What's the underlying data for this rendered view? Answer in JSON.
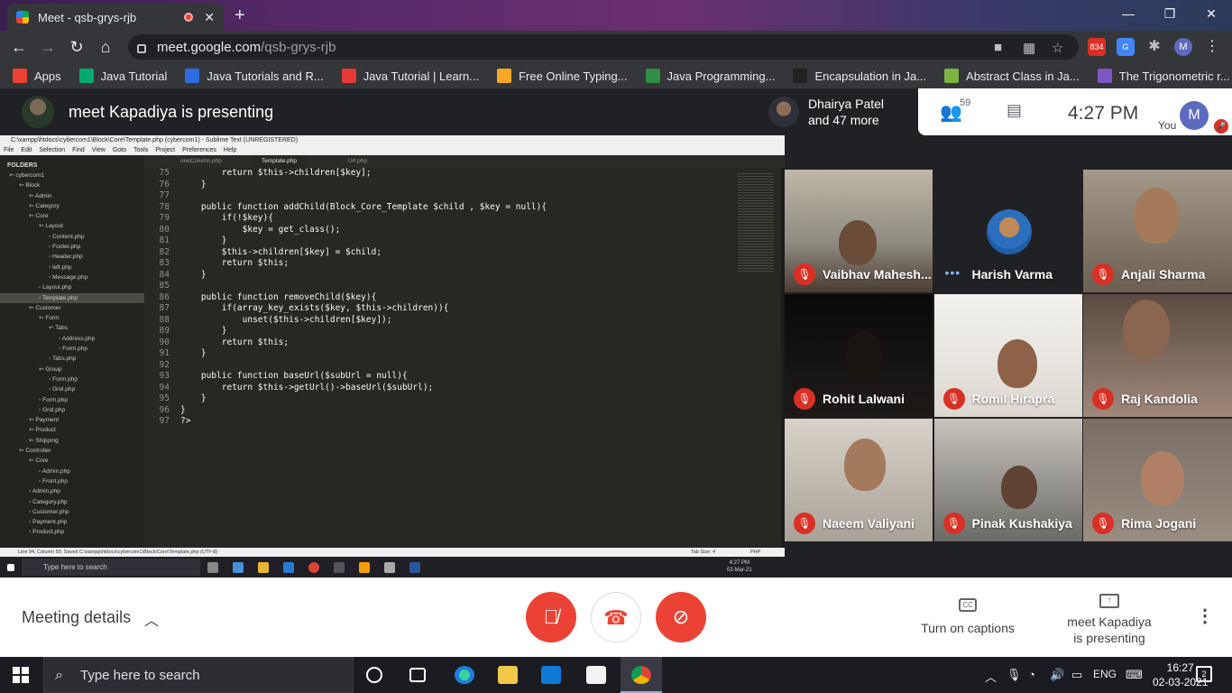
{
  "browser": {
    "tab_title": "Meet - qsb-grys-rjb",
    "new_tab": "+",
    "url_host": "meet.google.com",
    "url_path": "/qsb-grys-rjb",
    "ext_badge": "834"
  },
  "bookmarks": [
    {
      "label": "Apps",
      "icon": "apps-grid-icon",
      "color": "#ea4335"
    },
    {
      "label": "Java Tutorial",
      "icon": "w3-icon",
      "color": "#04aa6d"
    },
    {
      "label": "Java Tutorials and R...",
      "icon": "w-icon",
      "color": "#2b6cde"
    },
    {
      "label": "Java Tutorial | Learn...",
      "icon": "v-icon",
      "color": "#e53935"
    },
    {
      "label": "Free Online Typing...",
      "icon": "typing-icon",
      "color": "#f9a825"
    },
    {
      "label": "Java Programming...",
      "icon": "gfg-icon",
      "color": "#2f8d46"
    },
    {
      "label": "Encapsulation in Ja...",
      "icon": "s-icon",
      "color": "#222222"
    },
    {
      "label": "Abstract Class in Ja...",
      "icon": "b-icon",
      "color": "#7cb342"
    },
    {
      "label": "The Trigonometric r...",
      "icon": "f-icon",
      "color": "#7e57c2"
    }
  ],
  "meet": {
    "presenter_title": "meet Kapadiya is presenting",
    "others_line1": "Dhairya Patel",
    "others_line2": "and 47 more",
    "people_count": "59",
    "time": "4:27  PM",
    "you_label": "You",
    "me_initial": "M",
    "meeting_details": "Meeting details",
    "captions_label": "Turn on captions",
    "presenting_line1": "meet Kapadiya",
    "presenting_line2": "is presenting"
  },
  "participants": [
    {
      "name": "Vaibhav Mahesh...",
      "muted": true
    },
    {
      "name": "Harish Varma",
      "muted": false
    },
    {
      "name": "Anjali Sharma",
      "muted": true
    },
    {
      "name": "Rohit Lalwani",
      "muted": true
    },
    {
      "name": "Romil Hirapra",
      "muted": true
    },
    {
      "name": "Raj Kandolia",
      "muted": true
    },
    {
      "name": "Naeem Valiyani",
      "muted": true
    },
    {
      "name": "Pinak Kushakiya",
      "muted": true
    },
    {
      "name": "Rima Jogani",
      "muted": true
    }
  ],
  "editor": {
    "window_title": "C:\\xampp\\htdocs\\cybercom1\\Block\\Core\\Template.php (cybercom1) - Sublime Text (UNREGISTERED)",
    "menu": [
      "File",
      "Edit",
      "Selection",
      "Find",
      "View",
      "Goto",
      "Tools",
      "Project",
      "Preferences",
      "Help"
    ],
    "folders_label": "FOLDERS",
    "tabs": [
      "oneColumn.php",
      "Template.php",
      "Url.php"
    ],
    "tree": [
      {
        "label": "cybercom1",
        "depth": 0
      },
      {
        "label": "Block",
        "depth": 1
      },
      {
        "label": "Admin",
        "depth": 2
      },
      {
        "label": "Category",
        "depth": 2
      },
      {
        "label": "Core",
        "depth": 2
      },
      {
        "label": "Layout",
        "depth": 3
      },
      {
        "label": "Content.php",
        "depth": 4
      },
      {
        "label": "Footer.php",
        "depth": 4
      },
      {
        "label": "Header.php",
        "depth": 4
      },
      {
        "label": "left.php",
        "depth": 4
      },
      {
        "label": "Message.php",
        "depth": 4
      },
      {
        "label": "Layout.php",
        "depth": 3
      },
      {
        "label": "Template.php",
        "depth": 3
      },
      {
        "label": "Customer",
        "depth": 2
      },
      {
        "label": "Form",
        "depth": 3
      },
      {
        "label": "Tabs",
        "depth": 4
      },
      {
        "label": "Address.php",
        "depth": 5
      },
      {
        "label": "Form.php",
        "depth": 5
      },
      {
        "label": "Tabs.php",
        "depth": 4
      },
      {
        "label": "Group",
        "depth": 3
      },
      {
        "label": "Form.php",
        "depth": 4
      },
      {
        "label": "Grid.php",
        "depth": 4
      },
      {
        "label": "Form.php",
        "depth": 3
      },
      {
        "label": "Grid.php",
        "depth": 3
      },
      {
        "label": "Payment",
        "depth": 2
      },
      {
        "label": "Product",
        "depth": 2
      },
      {
        "label": "Shipping",
        "depth": 2
      },
      {
        "label": "Controller",
        "depth": 1
      },
      {
        "label": "Core",
        "depth": 2
      },
      {
        "label": "Admin.php",
        "depth": 3
      },
      {
        "label": "Front.php",
        "depth": 3
      },
      {
        "label": "Admin.php",
        "depth": 2
      },
      {
        "label": "Category.php",
        "depth": 2
      },
      {
        "label": "Customer.php",
        "depth": 2
      },
      {
        "label": "Payment.php",
        "depth": 2
      },
      {
        "label": "Product.php",
        "depth": 2
      }
    ],
    "line_numbers": [
      "75",
      "76",
      "77",
      "78",
      "79",
      "80",
      "81",
      "82",
      "83",
      "84",
      "85",
      "86",
      "87",
      "88",
      "89",
      "90",
      "91",
      "92",
      "93",
      "94",
      "95",
      "96",
      "97"
    ],
    "code_lines": [
      "        return $this->children[$key];",
      "    }",
      "",
      "    public function addChild(Block_Core_Template $child , $key = null){",
      "        if(!$key){",
      "            $key = get_class();",
      "        }",
      "        $this->children[$key] = $child;",
      "        return $this;",
      "    }",
      "",
      "    public function removeChild($key){",
      "        if(array_key_exists($key, $this->children)){",
      "            unset($this->children[$key]);",
      "        }",
      "        return $this;",
      "    }",
      "",
      "    public function baseUrl($subUrl = null){",
      "        return $this->getUrl()->baseUrl($subUrl);",
      "    }",
      "}",
      "?>"
    ],
    "status_text": "Line 94, Column 59; Saved C:\\xampp\\htdocs\\cybercom1\\Block\\Core\\Template.php (UTF-8)",
    "tab_size": "Tab Size: 4",
    "syntax": "PHP",
    "inner_search": "Type here to search",
    "inner_time": "4:27 PM",
    "inner_date": "02-Mar-21"
  },
  "taskbar": {
    "search": "Type here to search",
    "lang": "ENG",
    "time": "16:27",
    "date": "02-03-2021",
    "notifications": "2"
  }
}
